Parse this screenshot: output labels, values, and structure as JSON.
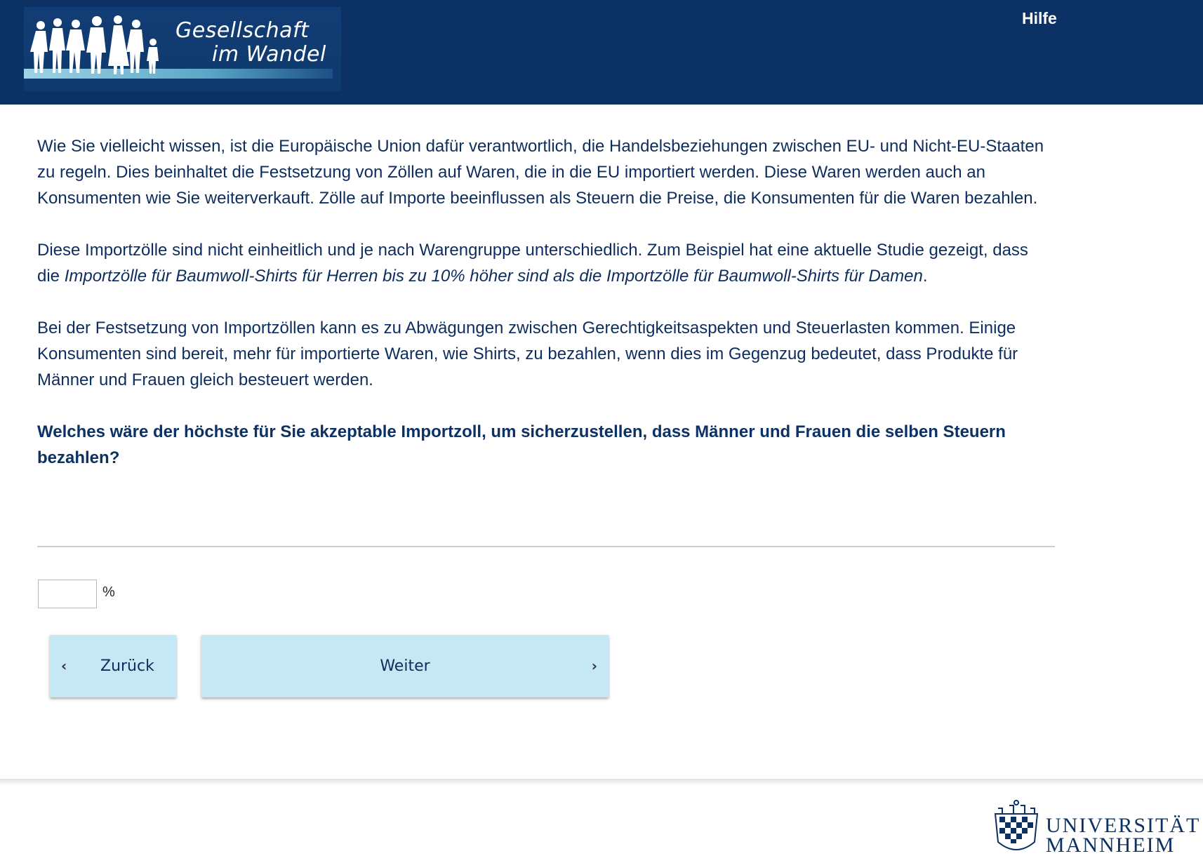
{
  "header": {
    "logo_line1": "Gesellschaft",
    "logo_line2": "im Wandel",
    "help_label": "Hilfe"
  },
  "intro": {
    "paragraph1": "Wie Sie vielleicht wissen, ist die Europäische Union dafür verantwortlich, die Handelsbeziehungen zwischen EU- und Nicht-EU-Staaten zu regeln. Dies beinhaltet die Festsetzung von Zöllen auf Waren, die in die EU importiert werden. Diese Waren werden auch an Konsumenten wie Sie weiterverkauft. Zölle auf Importe beeinflussen als Steuern die Preise, die Konsumenten für die Waren bezahlen.",
    "paragraph2_start": "Diese Importzölle sind nicht einheitlich und je nach Warengruppe unterschiedlich. Zum Beispiel hat eine aktuelle Studie gezeigt, dass die ",
    "paragraph2_emphasis": "Importzölle für Baumwoll-Shirts für Herren bis zu 10% höher sind als die Importzölle für Baumwoll-Shirts für Damen",
    "paragraph2_end": ".",
    "paragraph3": "Bei der Festsetzung von Importzöllen kann es zu Abwägungen zwischen Gerechtigkeitsaspekten und Steuerlasten kommen. Einige Konsumenten sind bereit, mehr für importierte Waren, wie Shirts, zu bezahlen, wenn dies im Gegenzug bedeutet, dass Produkte für Männer und Frauen gleich besteuert werden."
  },
  "question": {
    "text": "Welches wäre der höchste für Sie akzeptable Importzoll, um sicherzustellen, dass Männer und Frauen die selben Steuern bezahlen?",
    "input_value": "",
    "unit": "%"
  },
  "navigation": {
    "back_label": "Zurück",
    "next_label": "Weiter",
    "back_icon": "chevron-left-icon",
    "next_icon": "chevron-right-icon"
  },
  "footer": {
    "uni_line1": "UNIVERSITÄT",
    "uni_line2": "MANNHEIM"
  },
  "colors": {
    "header_bg": "#0b3165",
    "text": "#0d2d5e",
    "button_bg": "#c6e8f5"
  }
}
